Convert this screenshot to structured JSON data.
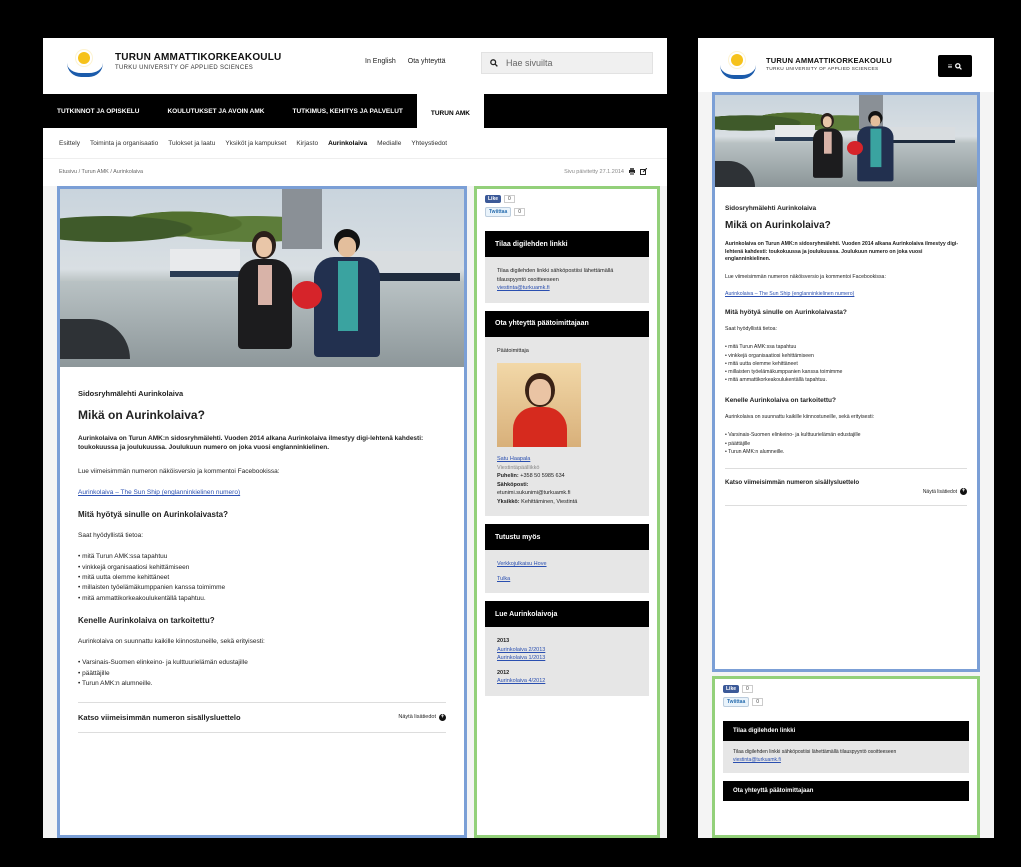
{
  "site": {
    "name_fi": "TURUN AMMATTIKORKEAKOULU",
    "name_en": "TURKU UNIVERSITY OF APPLIED SCIENCES"
  },
  "header": {
    "in_english": "In English",
    "contact": "Ota yhteyttä",
    "search_placeholder": "Hae sivuilta"
  },
  "nav": {
    "items": [
      "TUTKINNOT JA OPISKELU",
      "KOULUTUKSET JA AVOIN AMK",
      "TUTKIMUS, KEHITYS JA PALVELUT",
      "TURUN AMK"
    ]
  },
  "subnav": {
    "items": [
      "Esittely",
      "Toiminta ja organisaatio",
      "Tulokset ja laatu",
      "Yksiköt ja kampukset",
      "Kirjasto",
      "Aurinkolaiva",
      "Medialle",
      "Yhteystiedot"
    ]
  },
  "breadcrumb": "Etusivu  /  Turun AMK  /  Aurinkolaiva",
  "updated": "Sivu päivitetty 27.1.2014",
  "article": {
    "kicker": "Sidosryhmälehti Aurinkolaiva",
    "title": "Mikä on Aurinkolaiva?",
    "lead": "Aurinkolaiva on Turun AMK:n sidosryhmälehti. Vuoden 2014 alkana Aurinkolaiva ilmestyy digi-lehtenä kahdesti: toukokuussa ja joulukuussa. Joulukuun numero on joka vuosi englanninkielinen.",
    "p1": "Lue viimeisimmän numeron näköisversio ja kommentoi Facebookissa:",
    "link1": "Aurinkolaiva – The Sun Ship (englanninkielinen numero)",
    "h2a": "Mitä hyötyä sinulle on Aurinkolaivasta?",
    "p2": "Saat hyödyllistä tietoa:",
    "list1": [
      "mitä Turun AMK:ssa tapahtuu",
      "vinkkejä organisaatiosi kehittämiseen",
      "mitä uutta olemme kehittäneet",
      "millaisten työelämäkumppanien kanssa toimimme",
      "mitä ammattikorkeakoulukentällä tapahtuu."
    ],
    "h2b": "Kenelle Aurinkolaiva on tarkoitettu?",
    "p3": "Aurinkolaiva on suunnattu kaikille kiinnostuneille, sekä erityisesti:",
    "list2": [
      "Varsinais-Suomen elinkeino- ja kulttuurielämän edustajille",
      "päättäjille",
      "Turun AMK:n alumneille."
    ],
    "toc_title": "Katso viimeisimmän numeron sisällysluettelo",
    "toc_show": "Näytä lisätiedot"
  },
  "social": {
    "like": "Like",
    "like_count": "0",
    "tweet": "Twiittaa",
    "tweet_count": "0"
  },
  "sidebar": {
    "box1": {
      "title": "Tilaa digilehden linkki",
      "text": "Tilaa digilehden linkki sähköpostiisi lähettämällä tilauspyyntö osoitteeseen",
      "email": "viestinta@turkuamk.fi"
    },
    "box2": {
      "title": "Ota yhteyttä päätoimittajaan",
      "role": "Päätoimittaja",
      "name": "Satu Haapala",
      "position": "Viestintäpäällikkö",
      "phone_label": "Puhelin:",
      "phone": "+358 50 5985 634",
      "email_label": "Sähköposti:",
      "email": "etunimi.sukunimi@turkuamk.fi",
      "unit_label": "Yksikkö:",
      "unit": "Kehittäminen, Viestintä"
    },
    "box3": {
      "title": "Tutustu myös",
      "links": [
        "Verkkojulkaisu Hove",
        "Tulka"
      ]
    },
    "box4": {
      "title": "Lue Aurinkolaivoja",
      "year1": "2013",
      "links1": [
        "Aurinkolaiva 2/2013",
        "Aurinkolaiva 1/2013"
      ],
      "year2": "2012",
      "links2": [
        "Aurinkolaiva 4/2012"
      ]
    }
  },
  "colors": {
    "content_outline": "#7b9fd6",
    "sidebar_outline": "#93d07a",
    "nav_bg": "#000000",
    "link": "#2a4fb0"
  },
  "icons": [
    "search-icon",
    "menu-icon",
    "print-icon",
    "share-icon",
    "plus-icon"
  ]
}
